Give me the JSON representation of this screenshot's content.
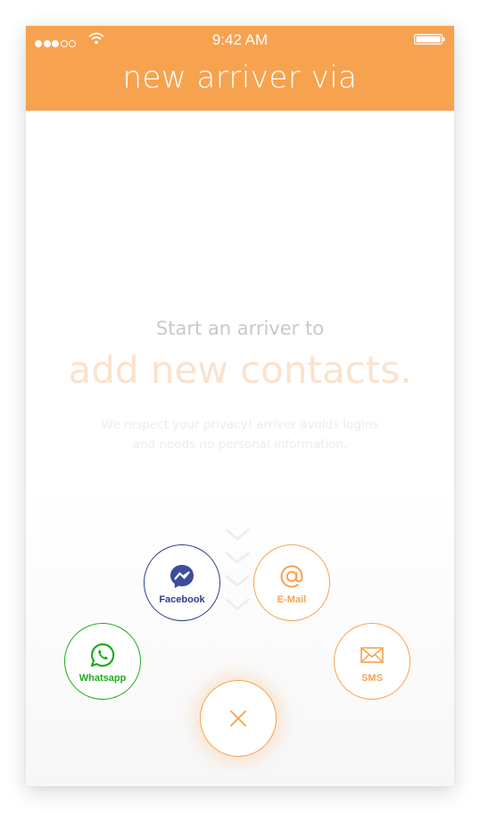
{
  "status_bar": {
    "time": "9:42 AM",
    "signal_bars_filled": 3,
    "signal_bars_total": 5
  },
  "header": {
    "title": "new arriver via"
  },
  "main": {
    "intro": "Start an arriver to",
    "headline": "add new contacts.",
    "privacy_line1": "We respect your privacy! arriver avoids logins",
    "privacy_line2": "and needs no personal information."
  },
  "share_options": {
    "facebook": {
      "label": "Facebook",
      "icon": "messenger-icon",
      "color": "#2d3e8c"
    },
    "email": {
      "label": "E-Mail",
      "icon": "at-icon",
      "color": "#f7a24f"
    },
    "whatsapp": {
      "label": "Whatsapp",
      "icon": "whatsapp-icon",
      "color": "#1cac1c"
    },
    "sms": {
      "label": "SMS",
      "icon": "envelope-icon",
      "color": "#f7a24f"
    }
  },
  "close": {
    "icon": "close-icon"
  },
  "colors": {
    "accent": "#f7a24f",
    "headline": "#fbe2cc",
    "intro": "#c9c9c9"
  }
}
